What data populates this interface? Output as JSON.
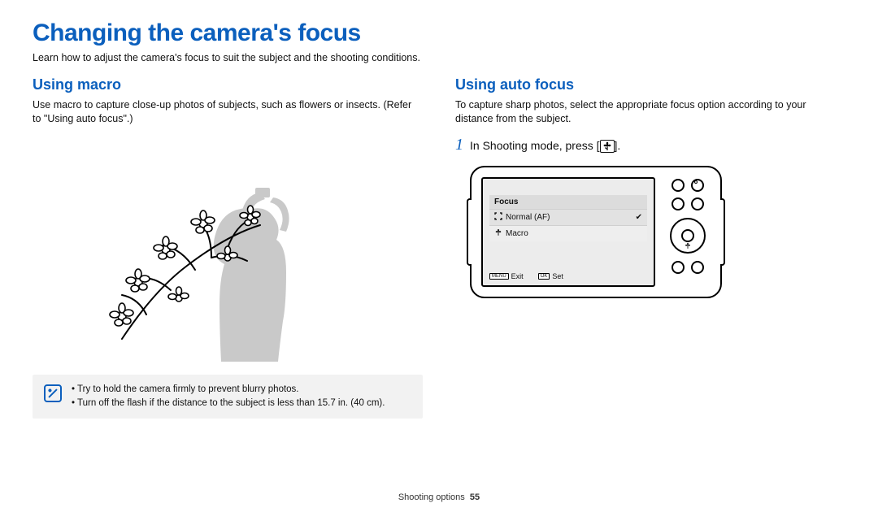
{
  "title": "Changing the camera's focus",
  "intro": "Learn how to adjust the camera's focus to suit the subject and the shooting conditions.",
  "left": {
    "heading": "Using macro",
    "body": "Use macro to capture close-up photos of subjects, such as flowers or insects. (Refer to \"Using auto focus\".)",
    "notes": [
      "Try to hold the camera firmly to prevent blurry photos.",
      "Turn off the flash if the distance to the subject is less than 15.7 in. (40 cm)."
    ]
  },
  "right": {
    "heading": "Using auto focus",
    "body": "To capture sharp photos, select the appropriate focus option according to your distance from the subject.",
    "step_num": "1",
    "step_text_pre": "In Shooting mode, press [",
    "step_icon": "macro-flower-icon",
    "step_text_post": "].",
    "lcd": {
      "menu_title": "Focus",
      "options": [
        {
          "icon": "af-bracket-icon",
          "label": "Normal (AF)",
          "selected": true
        },
        {
          "icon": "macro-flower-icon",
          "label": "Macro",
          "selected": false
        }
      ],
      "bottom": [
        {
          "key": "MENU",
          "label": "Exit"
        },
        {
          "key": "OK",
          "label": "Set"
        }
      ]
    }
  },
  "footer": {
    "section": "Shooting options",
    "page": "55"
  }
}
